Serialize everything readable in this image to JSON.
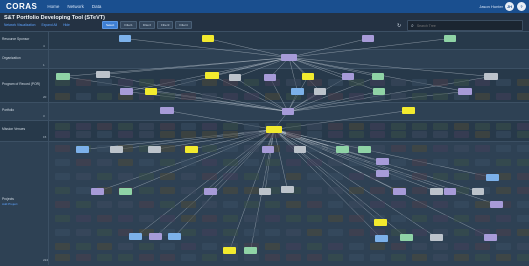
{
  "app": {
    "logo": "CORAS",
    "nav": [
      "Home",
      "Network",
      "Data"
    ],
    "user": "Jason Hunter",
    "avatar1": "JH",
    "avatar2": "?"
  },
  "header": {
    "title": "S&T Portfolio Developing Tool (STeVT)",
    "links": [
      "Network Visualization",
      "Expand All",
      "Hide"
    ],
    "filters": [
      "Select",
      "Filter1",
      "Filter2",
      "Filter3",
      "Filter4"
    ],
    "search_placeholder": "Search Tree",
    "refresh_icon": "refresh-icon",
    "search_icon": "search-icon"
  },
  "rows": [
    {
      "label": "Resource Sponsor",
      "count": "4"
    },
    {
      "label": "Organization",
      "count": "1"
    },
    {
      "label": "Program of Record (POR)",
      "count": "20"
    },
    {
      "label": "Portfolio",
      "count": "3"
    },
    {
      "label": "Mission Venues",
      "count": "15"
    },
    {
      "label": "Projects",
      "count": "224",
      "sub": "Add Project"
    }
  ],
  "colors": {
    "yellow": "#f2ea2e",
    "blue": "#7cb1ea",
    "purple": "#a79bd8",
    "green": "#8fd3a6",
    "gray": "#bcc3cb",
    "edge": "#c9d2db"
  }
}
